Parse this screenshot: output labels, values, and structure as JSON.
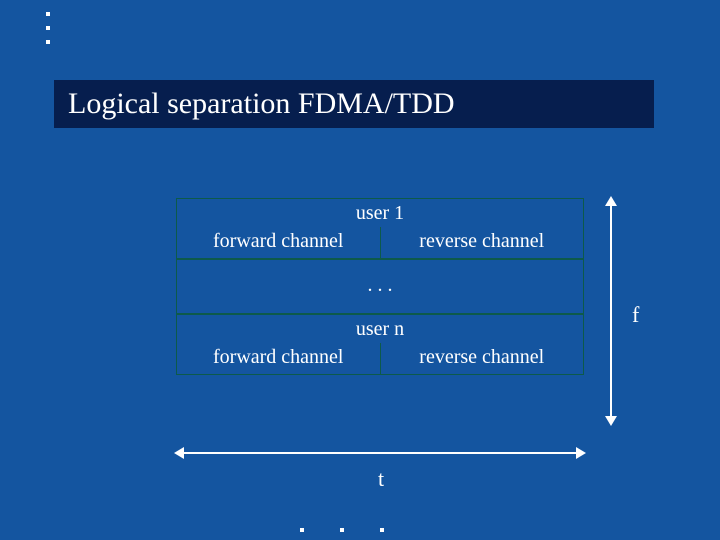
{
  "title": "Logical separation FDMA/TDD",
  "diagram": {
    "user1": {
      "header": "user 1",
      "forward": "forward channel",
      "reverse": "reverse channel"
    },
    "ellipsis": ". . .",
    "usern": {
      "header": "user n",
      "forward": "forward channel",
      "reverse": "reverse channel"
    }
  },
  "axes": {
    "f": "f",
    "t": "t"
  },
  "colors": {
    "background": "#1455A0",
    "title_bg": "#061E4E",
    "border": "#0D5A4A",
    "text": "#FFFFFF"
  }
}
